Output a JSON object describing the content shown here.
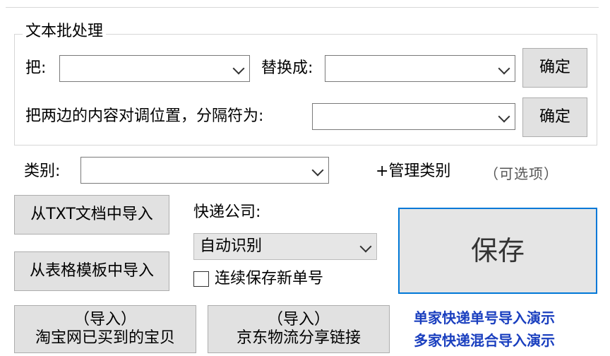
{
  "batch_group": {
    "title": "文本批处理",
    "replace_from_label": "把:",
    "replace_to_label": "替换成:",
    "confirm_label": "确定",
    "swap_label": "把两边的内容对调位置，分隔符为:",
    "swap_confirm_label": "确定"
  },
  "category": {
    "label": "类别:",
    "manage_label": "+管理类别",
    "optional_hint": "（可选项）"
  },
  "import_txt_label": "从TXT文档中导入",
  "import_excel_label": "从表格模板中导入",
  "courier": {
    "label": "快递公司:",
    "selected": "自动识别"
  },
  "continuous_save_label": "连续保存新单号",
  "save_label": "保存",
  "taobao_button": {
    "line1": "（导入）",
    "line2": "淘宝网已买到的宝贝"
  },
  "jd_button": {
    "line1": "（导入）",
    "line2": "京东物流分享链接"
  },
  "links": {
    "single_demo": "单家快递单号导入演示",
    "multi_demo": "多家快递混合导入演示"
  },
  "colors": {
    "accent": "#0078d7",
    "link": "#1a3fbf"
  }
}
